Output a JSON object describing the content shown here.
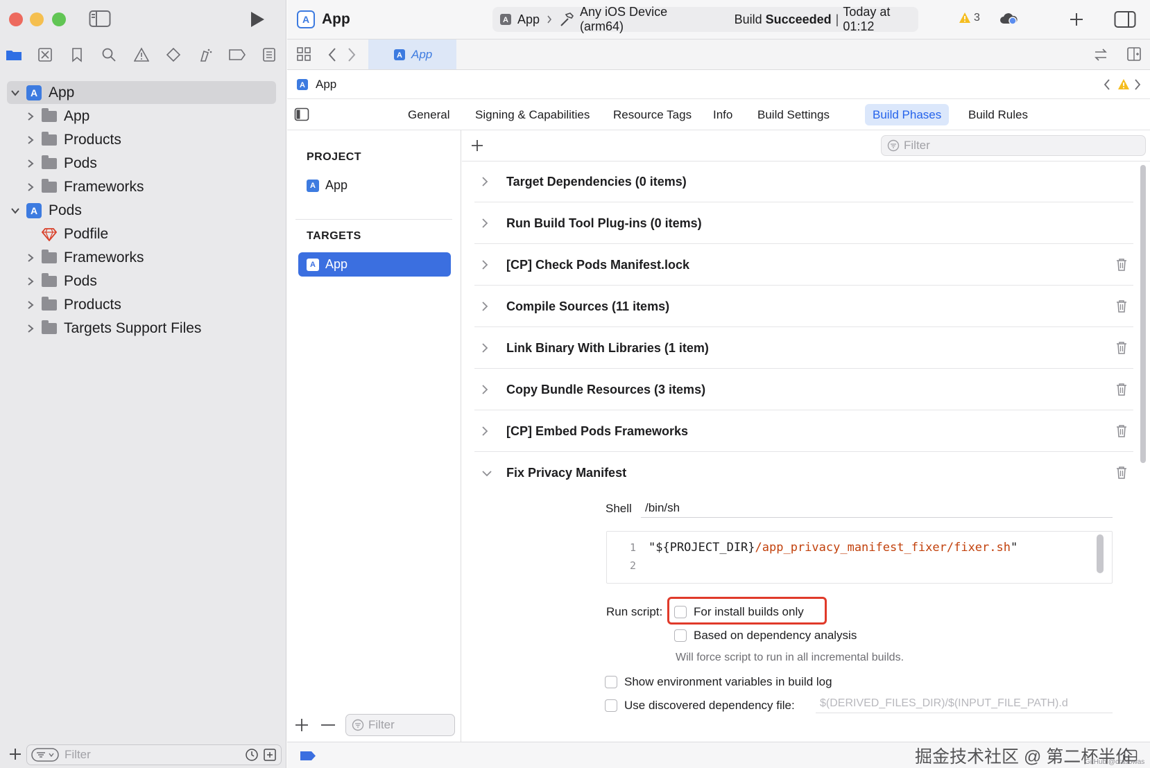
{
  "window": {
    "title": "App",
    "scheme": "App",
    "destination": "Any iOS Device (arm64)",
    "status_prefix": "Build",
    "status_bold": "Succeeded",
    "status_time": "Today at 01:12",
    "warning_count": "3"
  },
  "navigator": {
    "tree": [
      {
        "label": "App",
        "type": "project",
        "expanded": true,
        "level": 0
      },
      {
        "label": "App",
        "type": "folder",
        "level": 1
      },
      {
        "label": "Products",
        "type": "folder",
        "level": 1
      },
      {
        "label": "Pods",
        "type": "folder",
        "level": 1
      },
      {
        "label": "Frameworks",
        "type": "folder",
        "level": 1
      },
      {
        "label": "Pods",
        "type": "project",
        "expanded": true,
        "level": 0
      },
      {
        "label": "Podfile",
        "type": "ruby",
        "level": 1
      },
      {
        "label": "Frameworks",
        "type": "folder",
        "level": 1
      },
      {
        "label": "Pods",
        "type": "folder",
        "level": 1
      },
      {
        "label": "Products",
        "type": "folder",
        "level": 1
      },
      {
        "label": "Targets Support Files",
        "type": "folder",
        "level": 1
      }
    ],
    "filter_placeholder": "Filter"
  },
  "editor": {
    "tab_label": "App",
    "jump_label": "App",
    "tabs": [
      "General",
      "Signing & Capabilities",
      "Resource Tags",
      "Info",
      "Build Settings",
      "Build Phases",
      "Build Rules"
    ],
    "selected_tab": "Build Phases",
    "project_header": "PROJECT",
    "project_item": "App",
    "targets_header": "TARGETS",
    "target_item": "App",
    "targets_filter_placeholder": "Filter",
    "phases_filter_placeholder": "Filter"
  },
  "phases": [
    {
      "title": "Target Dependencies (0 items)",
      "deletable": false
    },
    {
      "title": "Run Build Tool Plug-ins (0 items)",
      "deletable": false
    },
    {
      "title": "[CP] Check Pods Manifest.lock",
      "deletable": true
    },
    {
      "title": "Compile Sources (11 items)",
      "deletable": true
    },
    {
      "title": "Link Binary With Libraries (1 item)",
      "deletable": true
    },
    {
      "title": "Copy Bundle Resources (3 items)",
      "deletable": true
    },
    {
      "title": "[CP] Embed Pods Frameworks",
      "deletable": true
    },
    {
      "title": "Fix Privacy Manifest",
      "deletable": true,
      "expanded": true
    }
  ],
  "script": {
    "shell_label": "Shell",
    "shell_value": "/bin/sh",
    "line_numbers": [
      "1",
      "2"
    ],
    "code_part1": "\"${PROJECT_DIR}",
    "code_part2": "/app_privacy_manifest_fixer/fixer.sh",
    "code_part3": "\"",
    "run_script_label": "Run script:",
    "install_builds_label": "For install builds only",
    "dependency_label": "Based on dependency analysis",
    "dependency_note": "Will force script to run in all incremental builds.",
    "env_vars_label": "Show environment variables in build log",
    "dep_file_label": "Use discovered dependency file:",
    "dep_file_placeholder": "$(DERIVED_FILES_DIR)/$(INPUT_FILE_PATH).d"
  },
  "watermark": {
    "text": "掘金技术社区 @ 第二杯半价",
    "small": "GitHub @crasowas"
  },
  "colors": {
    "accent": "#2563eb",
    "selection": "#3b6fe0",
    "highlight_box": "#e03a2a",
    "code_path": "#c2410c"
  }
}
